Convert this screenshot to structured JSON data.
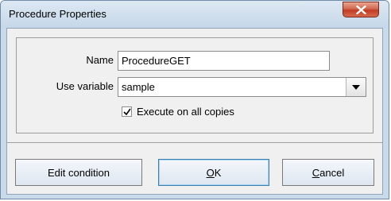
{
  "window": {
    "title": "Procedure Properties",
    "close_icon": "close-x-icon"
  },
  "form": {
    "name_label": "Name",
    "name_value": "ProcedureGET",
    "use_variable_label": "Use variable",
    "use_variable_value": "sample",
    "dropdown_icon": "chevron-down-icon",
    "execute_label": "Execute on all copies",
    "execute_checked": true
  },
  "buttons": {
    "edit_condition": "Edit condition",
    "ok_mnemonic": "O",
    "ok_rest": "K",
    "cancel_mnemonic": "C",
    "cancel_rest": "ancel"
  }
}
